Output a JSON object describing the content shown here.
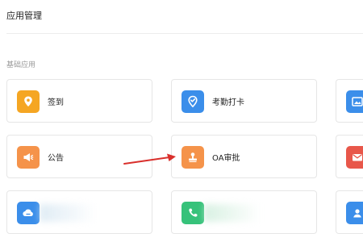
{
  "header": {
    "title": "应用管理"
  },
  "section": {
    "label": "基础应用"
  },
  "apps": [
    {
      "label": "签到",
      "icon": "location-pin-icon",
      "color": "#F5A623"
    },
    {
      "label": "考勤打卡",
      "icon": "check-badge-icon",
      "color": "#3B8EEA"
    },
    {
      "label": "",
      "icon": "image-icon",
      "color": "#3B8EEA"
    },
    {
      "label": "公告",
      "icon": "megaphone-icon",
      "color": "#F5934A"
    },
    {
      "label": "OA审批",
      "icon": "stamp-icon",
      "color": "#F5934A"
    },
    {
      "label": "",
      "icon": "mail-icon",
      "color": "#E8574A"
    },
    {
      "label": "",
      "icon": "cloud-icon",
      "color": "#3B8EEA"
    },
    {
      "label": "",
      "icon": "phone-icon",
      "color": "#36C27A"
    },
    {
      "label": "",
      "icon": "contact-icon",
      "color": "#3B8EEA"
    }
  ],
  "annotation": {
    "arrow_color": "#D9302C"
  }
}
